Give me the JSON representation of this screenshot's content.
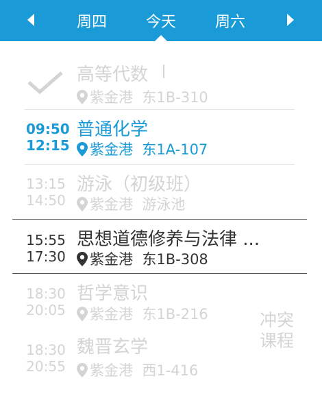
{
  "header": {
    "prev_day": "周四",
    "today": "今天",
    "next_day": "周六",
    "color": "#1a9bd7"
  },
  "items": [
    {
      "title": "高等代数",
      "campus": "紫金港",
      "room": "东1B-310",
      "status": "done",
      "icon": "checkmark-icon"
    },
    {
      "start": "09:50",
      "end": "12:15",
      "title": "普通化学",
      "campus": "紫金港",
      "room": "东1A-107",
      "status": "current",
      "color": "#1a9bd7"
    },
    {
      "start": "13:15",
      "end": "14:50",
      "title": "游泳（初级班）",
      "campus": "紫金港",
      "room": "游泳池",
      "status": "inactive"
    },
    {
      "start": "15:55",
      "end": "17:30",
      "title": "思想道德修养与法律 ...",
      "campus": "紫金港",
      "room": "东1B-308",
      "status": "selected"
    },
    {
      "start": "18:30",
      "end": "20:05",
      "title": "哲学意识",
      "campus": "紫金港",
      "room": "东1B-216",
      "status": "conflict"
    },
    {
      "start": "18:30",
      "end": "20:55",
      "title": "魏晋玄学",
      "campus": "紫金港",
      "room": "西1-416",
      "status": "conflict"
    }
  ],
  "conflict_label": "冲突\n课程",
  "colors": {
    "accent": "#1a9bd7",
    "faded": "#d4d4d4",
    "dark": "#333333"
  }
}
